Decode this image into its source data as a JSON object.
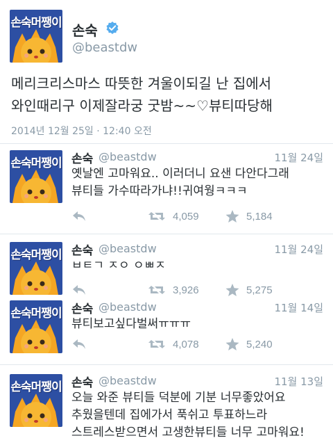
{
  "main_tweet": {
    "name": "손숙",
    "handle": "@beastdw",
    "avatar_text": "손숙머쨍이",
    "text_line1": "메리크리스마스 따뜻한 겨울이되길 난 집에서",
    "text_line2": "와인때리구 이제잘라궁 굿밤~~♡뷰티따당해",
    "timestamp": "2014년 12월 25일 · 12:40 오전",
    "verified_icon": "verified-badge-icon"
  },
  "tweets": [
    {
      "name": "손숙",
      "handle": "@beastdw",
      "date": "11월 24일",
      "avatar_text": "손숙머쨍이",
      "line1": "옛날엔 고마워요.. 이러더니 요샌 다안다그래",
      "line2": "뷰티들 가수따라가냐!!귀여웡ㅋㅋㅋ",
      "retweets": "4,059",
      "favorites": "5,184"
    },
    {
      "name": "손숙",
      "handle": "@beastdw",
      "date": "11월 24일",
      "avatar_text": "손숙머쨍이",
      "line1": "ㅂㅌㄱ ㅈㅇ ㅇㅃㅈ",
      "line2": "",
      "retweets": "3,926",
      "favorites": "5,275"
    },
    {
      "name": "손숙",
      "handle": "@beastdw",
      "date": "11월 14일",
      "avatar_text": "손숙머쨍이",
      "line1": "뷰티보고싶다벌써ㅠㅠㅠ",
      "line2": "",
      "retweets": "4,078",
      "favorites": "5,240"
    },
    {
      "name": "손숙",
      "handle": "@beastdw",
      "date": "11월 13일",
      "avatar_text": "손숙머쨍이",
      "line1": "오늘 와준 뷰티들 덕분에 기분 너무좋았어요",
      "line2": "추웠을텐데 집에가서 푹쉬고 투표하느라",
      "line3": "스트레스받으면서 고생한뷰티들 너무 고마워요!"
    }
  ],
  "colors": {
    "text": "#292f33",
    "muted": "#8899a6",
    "divider": "#e1e8ed",
    "verified": "#55acee",
    "avatar_bg": "#2d4fa3",
    "creature": "#f5a623"
  },
  "icons": {
    "reply": "reply-icon",
    "retweet": "retweet-icon",
    "favorite": "star-icon"
  }
}
